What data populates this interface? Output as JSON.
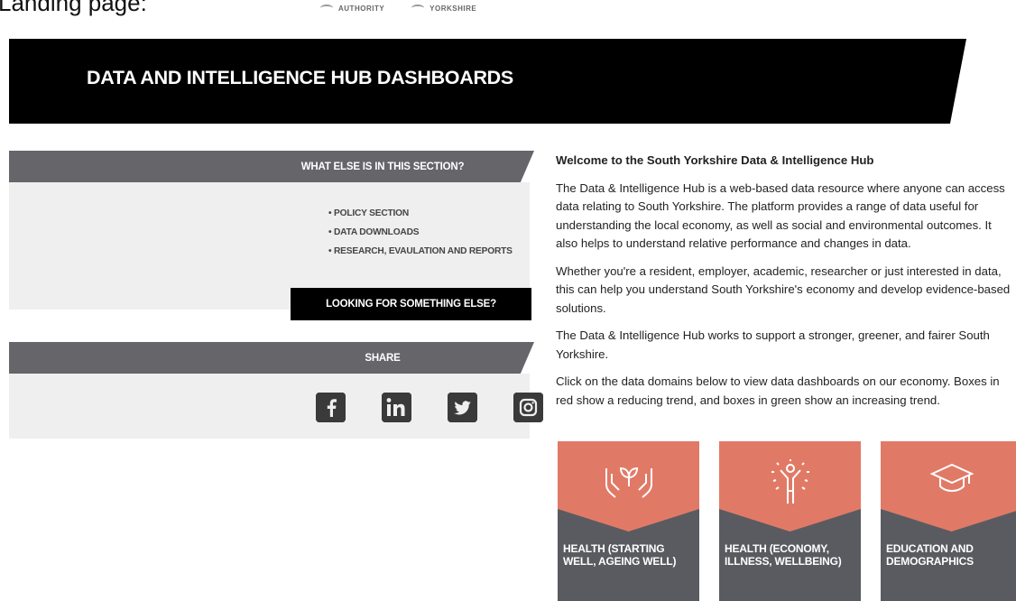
{
  "caption": "Landing page:",
  "logos": [
    "AUTHORITY",
    "YORKSHIRE"
  ],
  "hero": {
    "title": "DATA AND INTELLIGENCE HUB DASHBOARDS"
  },
  "sidebar": {
    "section_heading": "WHAT ELSE IS IN THIS SECTION?",
    "links": [
      "• POLICY SECTION",
      "• DATA DOWNLOADS",
      "• RESEARCH, EVAULATION AND REPORTS"
    ],
    "cta_label": "LOOKING FOR SOMETHING ELSE?",
    "share_heading": "SHARE",
    "social": [
      "facebook-icon",
      "linkedin-icon",
      "twitter-icon",
      "instagram-icon"
    ]
  },
  "intro": {
    "heading": "Welcome to the South Yorkshire Data & Intelligence Hub",
    "paragraphs": [
      "The Data & Intelligence Hub is a web-based data resource where anyone can access data relating to South Yorkshire. The platform provides a range of data useful for understanding the local economy, as well as social and environmental outcomes. It also helps to understand relative performance and changes in data.",
      "Whether you're a resident, employer, academic, researcher or just interested in data, this can help you understand South Yorkshire's economy and develop evidence-based solutions.",
      "The Data & Intelligence Hub works to support a stronger, greener, and fairer South Yorkshire.",
      "Click on the data domains below to view data dashboards on our economy. Boxes in red show a reducing trend, and boxes in green show an increasing trend."
    ]
  },
  "tiles": [
    {
      "label": "HEALTH (STARTING WELL, AGEING WELL)",
      "icon": "hands-plant-icon"
    },
    {
      "label": "HEALTH (ECONOMY, ILLNESS, WELLBEING)",
      "icon": "person-radiant-icon"
    },
    {
      "label": "EDUCATION AND DEMOGRAPHICS",
      "icon": "graduation-cap-icon"
    }
  ],
  "colors": {
    "hero_bg": "#000000",
    "panel_head": "#65656a",
    "panel_body": "#efefef",
    "tile_accent": "#e07a67",
    "tile_body": "#5a5b60"
  }
}
